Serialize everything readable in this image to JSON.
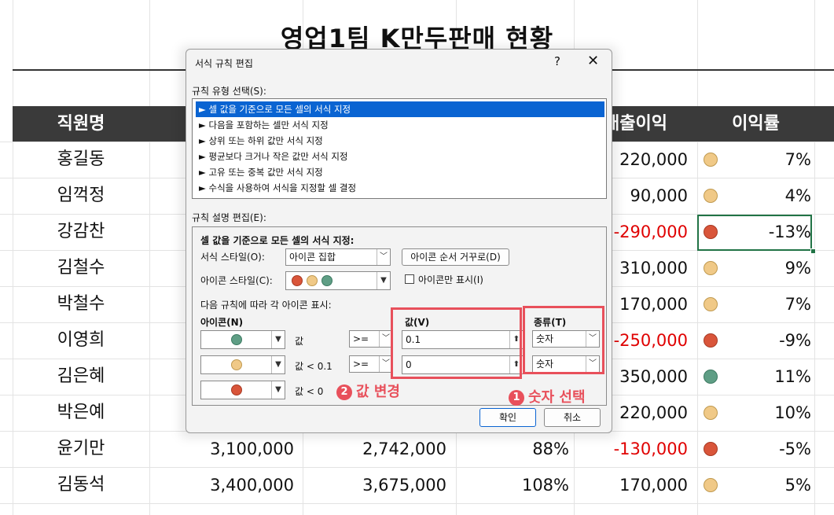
{
  "sheet": {
    "title": "영업1팀 K만두판매 현황",
    "headers": {
      "name": "직원명",
      "profit": "매출이익",
      "rate": "이익률"
    },
    "rows": [
      {
        "name": "홍길동",
        "c2": "",
        "c3": "",
        "c4": "",
        "profit": "220,000",
        "neg": false,
        "icon": "y",
        "rate": "7%"
      },
      {
        "name": "임꺽정",
        "c2": "",
        "c3": "",
        "c4": "",
        "profit": "90,000",
        "neg": false,
        "icon": "y",
        "rate": "4%"
      },
      {
        "name": "강감찬",
        "c2": "",
        "c3": "",
        "c4": "",
        "profit": "-290,000",
        "neg": true,
        "icon": "r",
        "rate": "-13%"
      },
      {
        "name": "김철수",
        "c2": "",
        "c3": "",
        "c4": "",
        "profit": "310,000",
        "neg": false,
        "icon": "y",
        "rate": "9%"
      },
      {
        "name": "박철수",
        "c2": "",
        "c3": "",
        "c4": "",
        "profit": "170,000",
        "neg": false,
        "icon": "y",
        "rate": "7%"
      },
      {
        "name": "이영희",
        "c2": "",
        "c3": "",
        "c4": "",
        "profit": "-250,000",
        "neg": true,
        "icon": "r",
        "rate": "-9%"
      },
      {
        "name": "김은혜",
        "c2": "",
        "c3": "",
        "c4": "",
        "profit": "350,000",
        "neg": false,
        "icon": "g",
        "rate": "11%"
      },
      {
        "name": "박은예",
        "c2": "",
        "c3": "",
        "c4": "",
        "profit": "220,000",
        "neg": false,
        "icon": "y",
        "rate": "10%"
      },
      {
        "name": "윤기만",
        "c2": "3,100,000",
        "c3": "2,742,000",
        "c4": "88%",
        "profit": "-130,000",
        "neg": true,
        "icon": "r",
        "rate": "-5%"
      },
      {
        "name": "김동석",
        "c2": "3,400,000",
        "c3": "3,675,000",
        "c4": "108%",
        "profit": "170,000",
        "neg": false,
        "icon": "y",
        "rate": "5%"
      }
    ]
  },
  "dialog": {
    "title": "서식 규칙 편집",
    "help": "?",
    "close": "✕",
    "rule_type_label": "규칙 유형 선택(S):",
    "rule_types": [
      "► 셀 값을 기준으로 모든 셀의 서식 지정",
      "► 다음을 포함하는 셀만 서식 지정",
      "► 상위 또는 하위 값만 서식 지정",
      "► 평균보다 크거나 작은 값만 서식 지정",
      "► 고유 또는 중복 값만 서식 지정",
      "► 수식을 사용하여 서식을 지정할 셀 결정"
    ],
    "edit_label": "규칙 설명 편집(E):",
    "desc_title": "셀 값을 기준으로 모든 셀의 서식 지정:",
    "format_style_label": "서식 스타일(O):",
    "format_style_value": "아이콘 집합",
    "reverse_button": "아이콘 순서 거꾸로(D)",
    "icon_style_label": "아이콘 스타일(C):",
    "icon_only_label": "아이콘만 표시(I)",
    "rule_caption": "다음 규칙에 따라 각 아이콘 표시:",
    "col_icon": "아이콘(N)",
    "col_value": "값(V)",
    "col_type": "종류(T)",
    "rules": [
      {
        "icon": "g",
        "cond": "값",
        "op": ">=",
        "value": "0.1",
        "type": "숫자"
      },
      {
        "icon": "y",
        "cond": "값 < 0.1",
        "op": ">=",
        "value": "0",
        "type": "숫자"
      },
      {
        "icon": "r",
        "cond": "값 < 0",
        "op": "",
        "value": "",
        "type": ""
      }
    ],
    "ok": "확인",
    "cancel": "취소"
  },
  "annotations": {
    "step1": "숫자 선택",
    "step1_num": "1",
    "step2": "값 변경",
    "step2_num": "2"
  },
  "colors": {
    "red_icon": "#d9553a",
    "yellow_icon": "#f0c987",
    "green_icon": "#5f9e85",
    "annotation": "#e8505b",
    "header_bg": "#3a3a3a",
    "selected": "#0a64d2"
  }
}
